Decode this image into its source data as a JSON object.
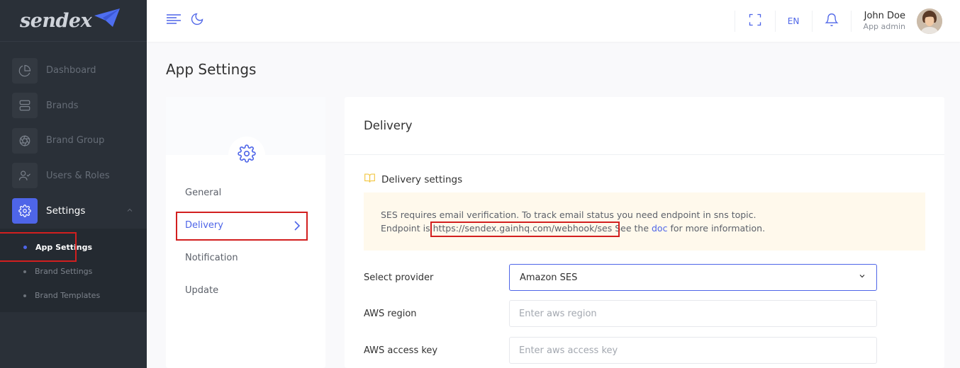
{
  "app": {
    "logo_text": "sendex"
  },
  "sidebar": {
    "items": [
      {
        "label": "Dashboard",
        "icon": "pie-chart-icon"
      },
      {
        "label": "Brands",
        "icon": "server-icon"
      },
      {
        "label": "Brand Group",
        "icon": "aperture-icon"
      },
      {
        "label": "Users & Roles",
        "icon": "user-check-icon"
      },
      {
        "label": "Settings",
        "icon": "gear-icon",
        "active": true
      }
    ],
    "sub_items": [
      {
        "label": "App Settings",
        "active": true
      },
      {
        "label": "Brand Settings"
      },
      {
        "label": "Brand Templates"
      }
    ]
  },
  "header": {
    "language": "EN",
    "user_name": "John Doe",
    "user_role": "App admin"
  },
  "page": {
    "title": "App Settings"
  },
  "settings_tabs": [
    {
      "label": "General"
    },
    {
      "label": "Delivery",
      "active": true
    },
    {
      "label": "Notification"
    },
    {
      "label": "Update"
    }
  ],
  "delivery": {
    "title": "Delivery",
    "section_title": "Delivery settings",
    "note_line1": "SES requires email verification. To track email status you need endpoint in sns topic.",
    "note_prefix": "Endpoint is ",
    "endpoint_url": "https://sendex.gainhq.com/webhook/ses",
    "note_see": " See the ",
    "doc_link": "doc",
    "note_suffix": " for more information.",
    "fields": {
      "provider_label": "Select provider",
      "provider_value": "Amazon SES",
      "region_label": "AWS region",
      "region_placeholder": "Enter aws region",
      "access_key_label": "AWS access key",
      "access_key_placeholder": "Enter aws access key"
    }
  },
  "colors": {
    "accent": "#4e65e8",
    "sidebar_bg": "#2a3038",
    "highlight": "#d21f1f",
    "note_bg": "#fff9ec"
  }
}
